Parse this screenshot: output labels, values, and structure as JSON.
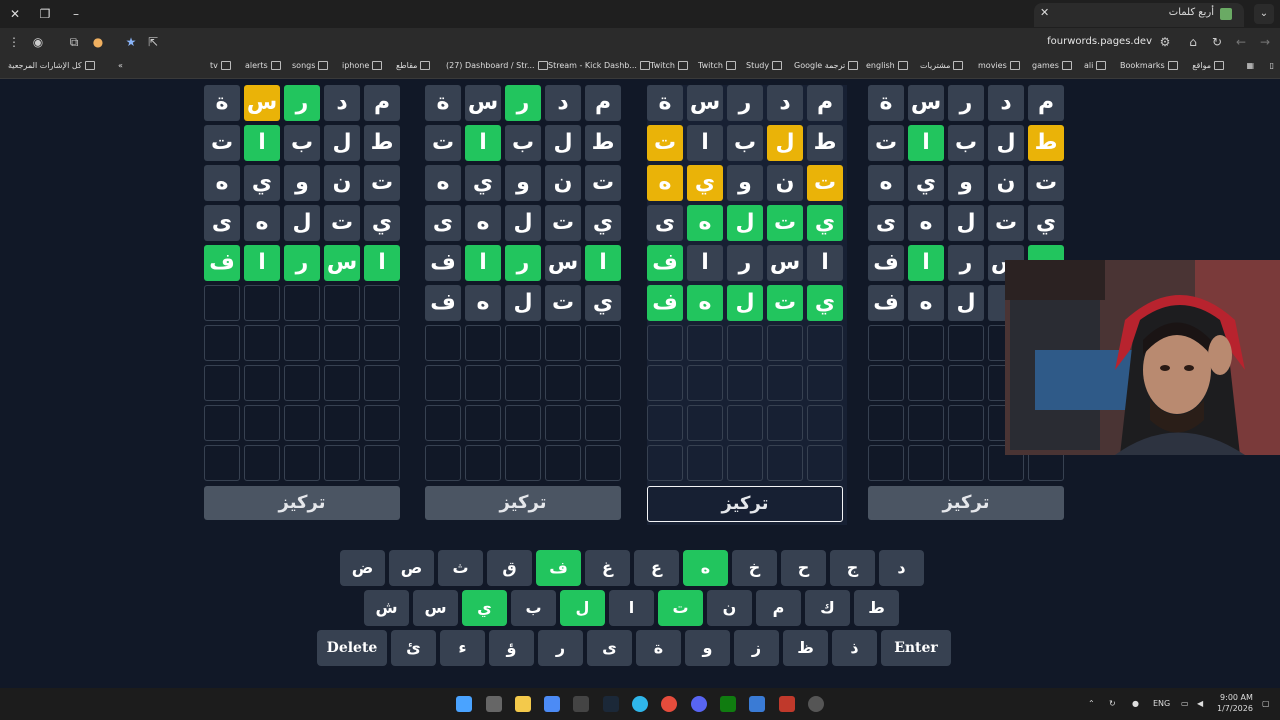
{
  "browser": {
    "tab_title": "أربع كلمات",
    "url": "fourwords.pages.dev",
    "bookmarks": [
      "Bookmarks",
      "ali",
      "games",
      "movies",
      "مشتريات",
      "english",
      "Google ترجمة",
      "Study",
      "Twitch",
      "Twitch",
      "Stream - Kick Dashb...",
      "(27) Dashboard / Str...",
      "مقاطع",
      "iphone",
      "songs",
      "alerts",
      "tv"
    ],
    "all_bookmarks": "كل الإشارات المرجعية",
    "site_bookmark": "مواقع"
  },
  "game": {
    "focus_label": "تركيز",
    "boards": [
      {
        "rows": [
          [
            {
              "l": "م",
              "s": "n"
            },
            {
              "l": "د",
              "s": "n"
            },
            {
              "l": "ر",
              "s": "g"
            },
            {
              "l": "س",
              "s": "y"
            },
            {
              "l": "ة",
              "s": "n"
            }
          ],
          [
            {
              "l": "ط",
              "s": "n"
            },
            {
              "l": "ل",
              "s": "n"
            },
            {
              "l": "ب",
              "s": "n"
            },
            {
              "l": "ا",
              "s": "g"
            },
            {
              "l": "ت",
              "s": "n"
            }
          ],
          [
            {
              "l": "ت",
              "s": "n"
            },
            {
              "l": "ن",
              "s": "n"
            },
            {
              "l": "و",
              "s": "n"
            },
            {
              "l": "ي",
              "s": "n"
            },
            {
              "l": "ه",
              "s": "n"
            }
          ],
          [
            {
              "l": "ي",
              "s": "n"
            },
            {
              "l": "ت",
              "s": "n"
            },
            {
              "l": "ل",
              "s": "n"
            },
            {
              "l": "ه",
              "s": "n"
            },
            {
              "l": "ى",
              "s": "n"
            }
          ],
          [
            {
              "l": "ا",
              "s": "g"
            },
            {
              "l": "س",
              "s": "g"
            },
            {
              "l": "ر",
              "s": "g"
            },
            {
              "l": "ا",
              "s": "g"
            },
            {
              "l": "ف",
              "s": "g"
            }
          ]
        ]
      },
      {
        "rows": [
          [
            {
              "l": "م",
              "s": "n"
            },
            {
              "l": "د",
              "s": "n"
            },
            {
              "l": "ر",
              "s": "g"
            },
            {
              "l": "س",
              "s": "n"
            },
            {
              "l": "ة",
              "s": "n"
            }
          ],
          [
            {
              "l": "ط",
              "s": "n"
            },
            {
              "l": "ل",
              "s": "n"
            },
            {
              "l": "ب",
              "s": "n"
            },
            {
              "l": "ا",
              "s": "g"
            },
            {
              "l": "ت",
              "s": "n"
            }
          ],
          [
            {
              "l": "ت",
              "s": "n"
            },
            {
              "l": "ن",
              "s": "n"
            },
            {
              "l": "و",
              "s": "n"
            },
            {
              "l": "ي",
              "s": "n"
            },
            {
              "l": "ه",
              "s": "n"
            }
          ],
          [
            {
              "l": "ي",
              "s": "n"
            },
            {
              "l": "ت",
              "s": "n"
            },
            {
              "l": "ل",
              "s": "n"
            },
            {
              "l": "ه",
              "s": "n"
            },
            {
              "l": "ى",
              "s": "n"
            }
          ],
          [
            {
              "l": "ا",
              "s": "g"
            },
            {
              "l": "س",
              "s": "n"
            },
            {
              "l": "ر",
              "s": "g"
            },
            {
              "l": "ا",
              "s": "g"
            },
            {
              "l": "ف",
              "s": "n"
            }
          ],
          [
            {
              "l": "ي",
              "s": "n"
            },
            {
              "l": "ت",
              "s": "n"
            },
            {
              "l": "ل",
              "s": "n"
            },
            {
              "l": "ه",
              "s": "n"
            },
            {
              "l": "ف",
              "s": "n"
            }
          ]
        ]
      },
      {
        "rows": [
          [
            {
              "l": "م",
              "s": "n"
            },
            {
              "l": "د",
              "s": "n"
            },
            {
              "l": "ر",
              "s": "n"
            },
            {
              "l": "س",
              "s": "n"
            },
            {
              "l": "ة",
              "s": "n"
            }
          ],
          [
            {
              "l": "ط",
              "s": "n"
            },
            {
              "l": "ل",
              "s": "y"
            },
            {
              "l": "ب",
              "s": "n"
            },
            {
              "l": "ا",
              "s": "n"
            },
            {
              "l": "ت",
              "s": "y"
            }
          ],
          [
            {
              "l": "ت",
              "s": "y"
            },
            {
              "l": "ن",
              "s": "n"
            },
            {
              "l": "و",
              "s": "n"
            },
            {
              "l": "ي",
              "s": "y"
            },
            {
              "l": "ه",
              "s": "y"
            }
          ],
          [
            {
              "l": "ي",
              "s": "g"
            },
            {
              "l": "ت",
              "s": "g"
            },
            {
              "l": "ل",
              "s": "g"
            },
            {
              "l": "ه",
              "s": "g"
            },
            {
              "l": "ى",
              "s": "n"
            }
          ],
          [
            {
              "l": "ا",
              "s": "n"
            },
            {
              "l": "س",
              "s": "n"
            },
            {
              "l": "ر",
              "s": "n"
            },
            {
              "l": "ا",
              "s": "n"
            },
            {
              "l": "ف",
              "s": "g"
            }
          ],
          [
            {
              "l": "ي",
              "s": "g"
            },
            {
              "l": "ت",
              "s": "g"
            },
            {
              "l": "ل",
              "s": "g"
            },
            {
              "l": "ه",
              "s": "g"
            },
            {
              "l": "ف",
              "s": "g"
            }
          ]
        ]
      },
      {
        "rows": [
          [
            {
              "l": "م",
              "s": "n"
            },
            {
              "l": "د",
              "s": "n"
            },
            {
              "l": "ر",
              "s": "n"
            },
            {
              "l": "س",
              "s": "n"
            },
            {
              "l": "ة",
              "s": "n"
            }
          ],
          [
            {
              "l": "ط",
              "s": "y"
            },
            {
              "l": "ل",
              "s": "n"
            },
            {
              "l": "ب",
              "s": "n"
            },
            {
              "l": "ا",
              "s": "g"
            },
            {
              "l": "ت",
              "s": "n"
            }
          ],
          [
            {
              "l": "ت",
              "s": "n"
            },
            {
              "l": "ن",
              "s": "n"
            },
            {
              "l": "و",
              "s": "n"
            },
            {
              "l": "ي",
              "s": "n"
            },
            {
              "l": "ه",
              "s": "n"
            }
          ],
          [
            {
              "l": "ي",
              "s": "n"
            },
            {
              "l": "ت",
              "s": "n"
            },
            {
              "l": "ل",
              "s": "n"
            },
            {
              "l": "ه",
              "s": "n"
            },
            {
              "l": "ى",
              "s": "n"
            }
          ],
          [
            {
              "l": "",
              "s": "g"
            },
            {
              "l": "س",
              "s": "n"
            },
            {
              "l": "ر",
              "s": "n"
            },
            {
              "l": "ا",
              "s": "g"
            },
            {
              "l": "ف",
              "s": "n"
            }
          ],
          [
            {
              "l": "",
              "s": "n"
            },
            {
              "l": "",
              "s": "n"
            },
            {
              "l": "ل",
              "s": "n"
            },
            {
              "l": "ه",
              "s": "n"
            },
            {
              "l": "ف",
              "s": "n"
            }
          ]
        ]
      }
    ],
    "keyboard": {
      "row1": [
        {
          "k": "د"
        },
        {
          "k": "ج"
        },
        {
          "k": "ح"
        },
        {
          "k": "خ"
        },
        {
          "k": "ه",
          "g": true
        },
        {
          "k": "ع"
        },
        {
          "k": "غ"
        },
        {
          "k": "ف",
          "g": true
        },
        {
          "k": "ق"
        },
        {
          "k": "ث"
        },
        {
          "k": "ص"
        },
        {
          "k": "ض"
        }
      ],
      "row2": [
        {
          "k": "ط"
        },
        {
          "k": "ك"
        },
        {
          "k": "م"
        },
        {
          "k": "ن"
        },
        {
          "k": "ت",
          "g": true
        },
        {
          "k": "ا"
        },
        {
          "k": "ل",
          "g": true
        },
        {
          "k": "ب"
        },
        {
          "k": "ي",
          "g": true
        },
        {
          "k": "س"
        },
        {
          "k": "ش"
        }
      ],
      "row3": [
        {
          "k": "Enter",
          "wide": true
        },
        {
          "k": "ذ"
        },
        {
          "k": "ظ"
        },
        {
          "k": "ز"
        },
        {
          "k": "و"
        },
        {
          "k": "ة"
        },
        {
          "k": "ى"
        },
        {
          "k": "ر"
        },
        {
          "k": "ؤ"
        },
        {
          "k": "ء"
        },
        {
          "k": "ئ"
        },
        {
          "k": "Delete",
          "wide": true
        }
      ]
    }
  },
  "taskbar": {
    "lang": "ENG",
    "time": "9:00 AM",
    "date": "1/7/2026"
  },
  "colors": {
    "green": "#22c55e",
    "yellow": "#eab308",
    "tile": "#374151",
    "bg": "#111827"
  }
}
